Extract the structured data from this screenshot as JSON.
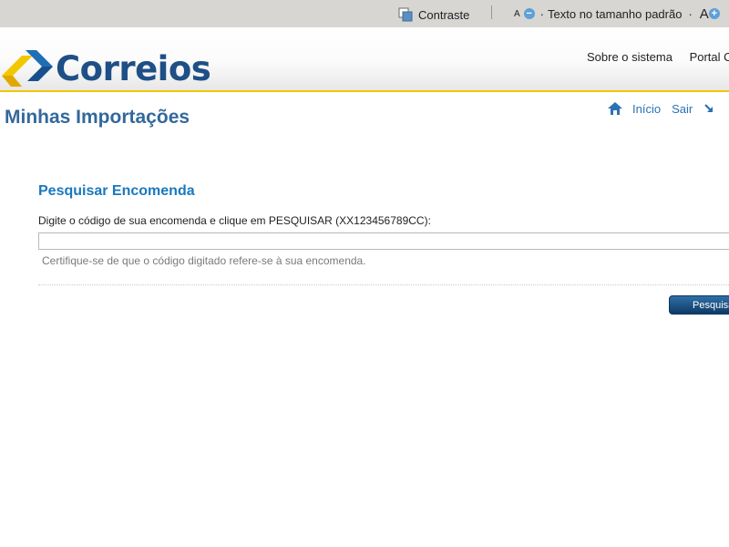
{
  "accessibility": {
    "contrast_label": "Contraste",
    "font_small": "A",
    "font_minus": "−",
    "font_default_label": "Texto no tamanho padrão",
    "font_large": "A",
    "font_plus": "+",
    "separator": "·"
  },
  "header": {
    "logo_text": "Correios",
    "links": [
      "Sobre o sistema",
      "Portal C"
    ]
  },
  "page": {
    "title": "Minhas Importações"
  },
  "nav": {
    "home_label": "Início",
    "exit_label": "Sair"
  },
  "search": {
    "title": "Pesquisar Encomenda",
    "instruction": "Digite o código de sua encomenda e clique em PESQUISAR (XX123456789CC):",
    "input_value": "",
    "hint": "Certifique-se de que o código digitado refere-se à sua encomenda.",
    "button_label": "Pesquisar"
  },
  "colors": {
    "brand_blue": "#1e4f86",
    "brand_yellow": "#f2c700",
    "title_blue": "#33689b",
    "link_blue": "#2a72b5"
  }
}
